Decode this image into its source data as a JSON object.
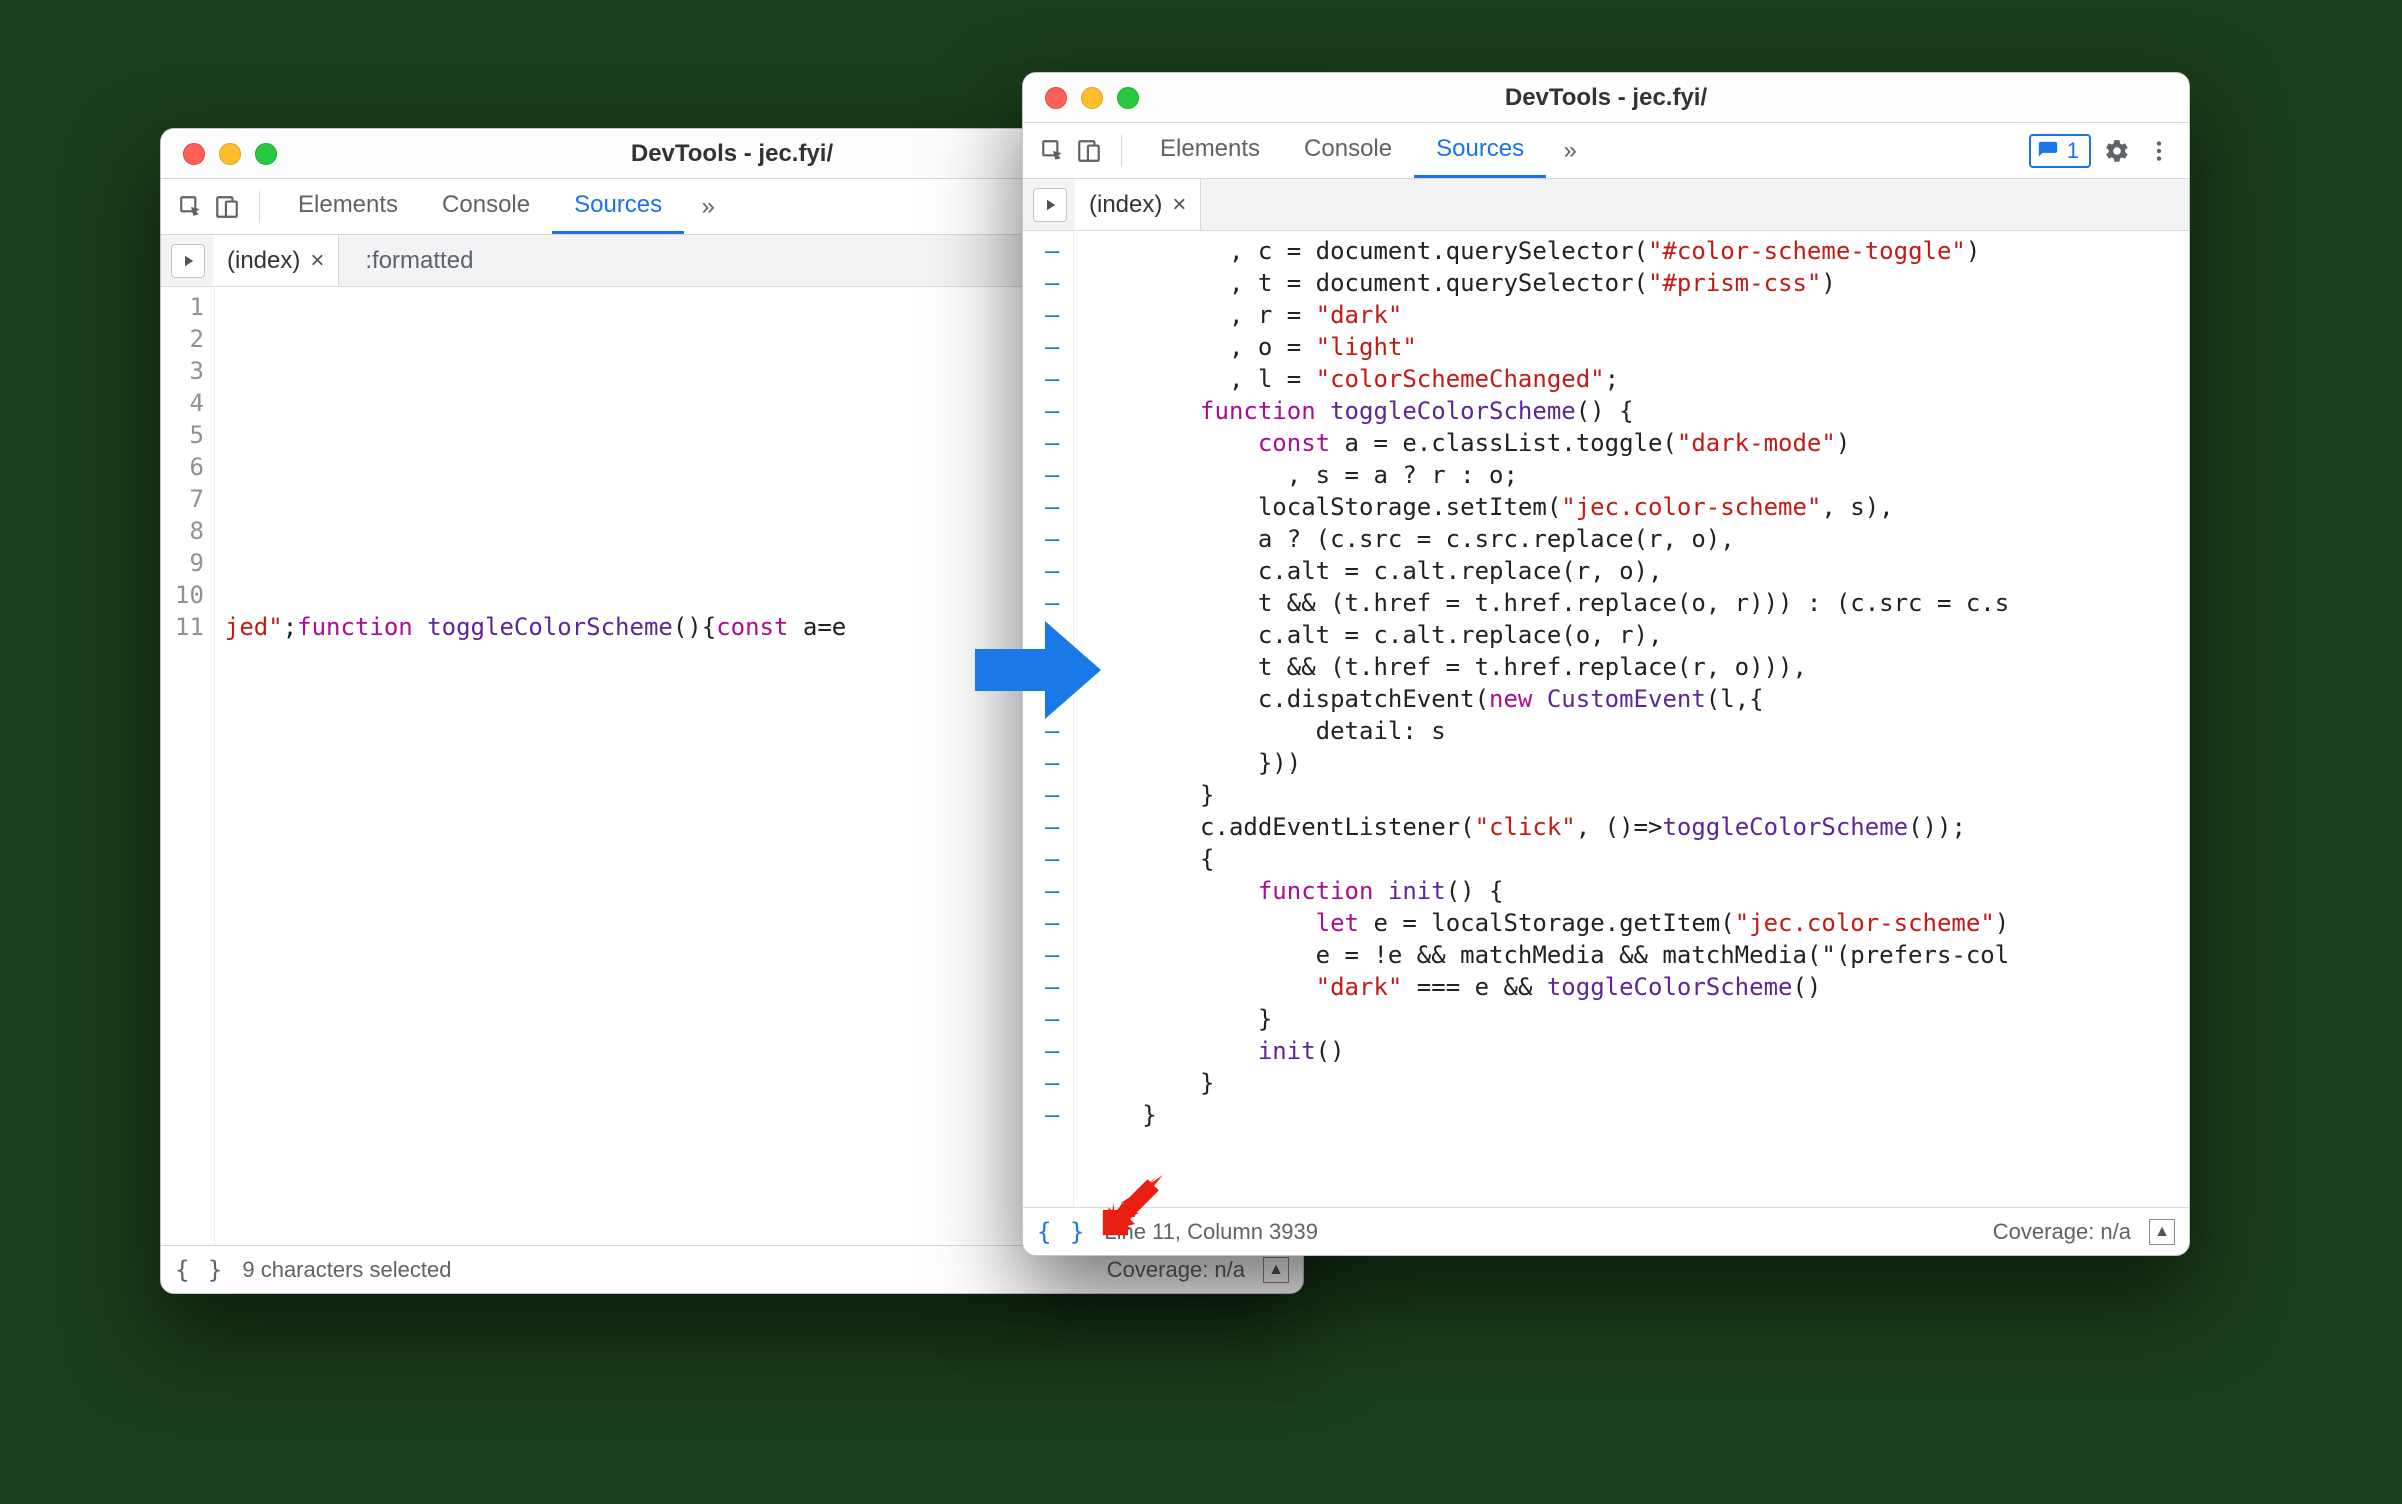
{
  "left": {
    "title": "DevTools - jec.fyi/",
    "tabs": {
      "elements": "Elements",
      "console": "Console",
      "sources": "Sources"
    },
    "more": "»",
    "file_tab": "(index)",
    "formatted_label": ":formatted",
    "line_numbers": [
      "1",
      "2",
      "3",
      "4",
      "5",
      "6",
      "7",
      "8",
      "9",
      "10",
      "11"
    ],
    "code_l11_seg1": "jed\"",
    "code_l11_seg2": ";",
    "code_l11_kw1": "function",
    "code_l11_fn": " toggleColorScheme",
    "code_l11_seg3": "(){",
    "code_l11_kw2": "const",
    "code_l11_seg4": " a=e",
    "status_left": "9 characters selected",
    "coverage": "Coverage: n/a"
  },
  "right": {
    "title": "DevTools - jec.fyi/",
    "tabs": {
      "elements": "Elements",
      "console": "Console",
      "sources": "Sources"
    },
    "more": "»",
    "issues_count": "1",
    "file_tab": "(index)",
    "code_lines": [
      "          , c = document.querySelector(\"#color-scheme-toggle\")",
      "          , t = document.querySelector(\"#prism-css\")",
      "          , r = \"dark\"",
      "          , o = \"light\"",
      "          , l = \"colorSchemeChanged\";",
      "        function toggleColorScheme() {",
      "            const a = e.classList.toggle(\"dark-mode\")",
      "              , s = a ? r : o;",
      "            localStorage.setItem(\"jec.color-scheme\", s),",
      "            a ? (c.src = c.src.replace(r, o),",
      "            c.alt = c.alt.replace(r, o),",
      "            t && (t.href = t.href.replace(o, r))) : (c.src = c.s",
      "            c.alt = c.alt.replace(o, r),",
      "            t && (t.href = t.href.replace(r, o))),",
      "            c.dispatchEvent(new CustomEvent(l,{",
      "                detail: s",
      "            }))",
      "        }",
      "        c.addEventListener(\"click\", ()=>toggleColorScheme());",
      "        {",
      "            function init() {",
      "                let e = localStorage.getItem(\"jec.color-scheme\")",
      "                e = !e && matchMedia && matchMedia(\"(prefers-col",
      "                \"dark\" === e && toggleColorScheme()",
      "            }",
      "            init()",
      "        }",
      "    }"
    ],
    "status_left": "Line 11, Column 3939",
    "coverage": "Coverage: n/a"
  }
}
